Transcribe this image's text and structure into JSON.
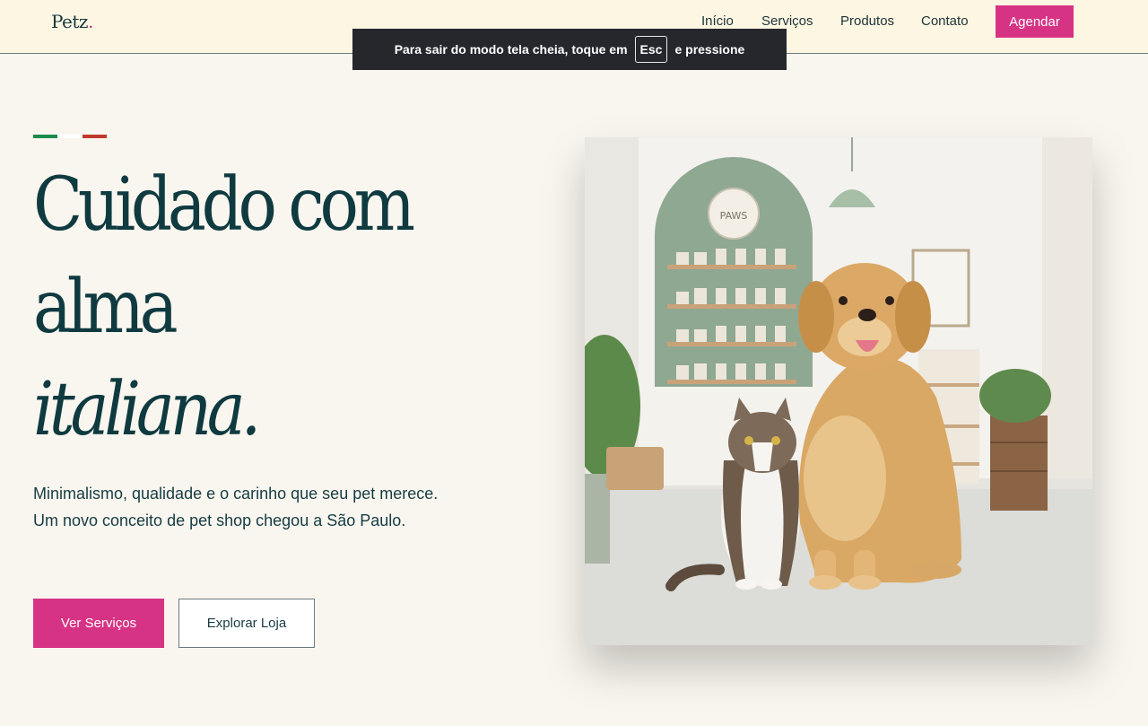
{
  "header": {
    "logo_text": "Petz",
    "logo_dot": ".",
    "nav": [
      "Início",
      "Serviços",
      "Produtos",
      "Contato"
    ],
    "cta_label": "Agendar"
  },
  "fullscreen_notice": {
    "before": "Para sair do modo tela cheia, toque em",
    "key": "Esc",
    "after": "e pressione"
  },
  "hero": {
    "headline_lines": [
      "Cuidado com",
      "alma"
    ],
    "headline_italic": "italiana.",
    "subtitle": "Minimalismo, qualidade e o carinho que seu pet merece. Um novo conceito de pet shop chegou a São Paulo.",
    "primary_button": "Ver Serviços",
    "secondary_button": "Explorar Loja",
    "image_sign_text": "PAWS"
  },
  "colors": {
    "accent": "#d63384",
    "text": "#0f3a40",
    "background": "#f9f6ef",
    "header_bg": "#fdf6e3",
    "flag": [
      "#1b8a4a",
      "#ffffff",
      "#c0392b"
    ]
  }
}
